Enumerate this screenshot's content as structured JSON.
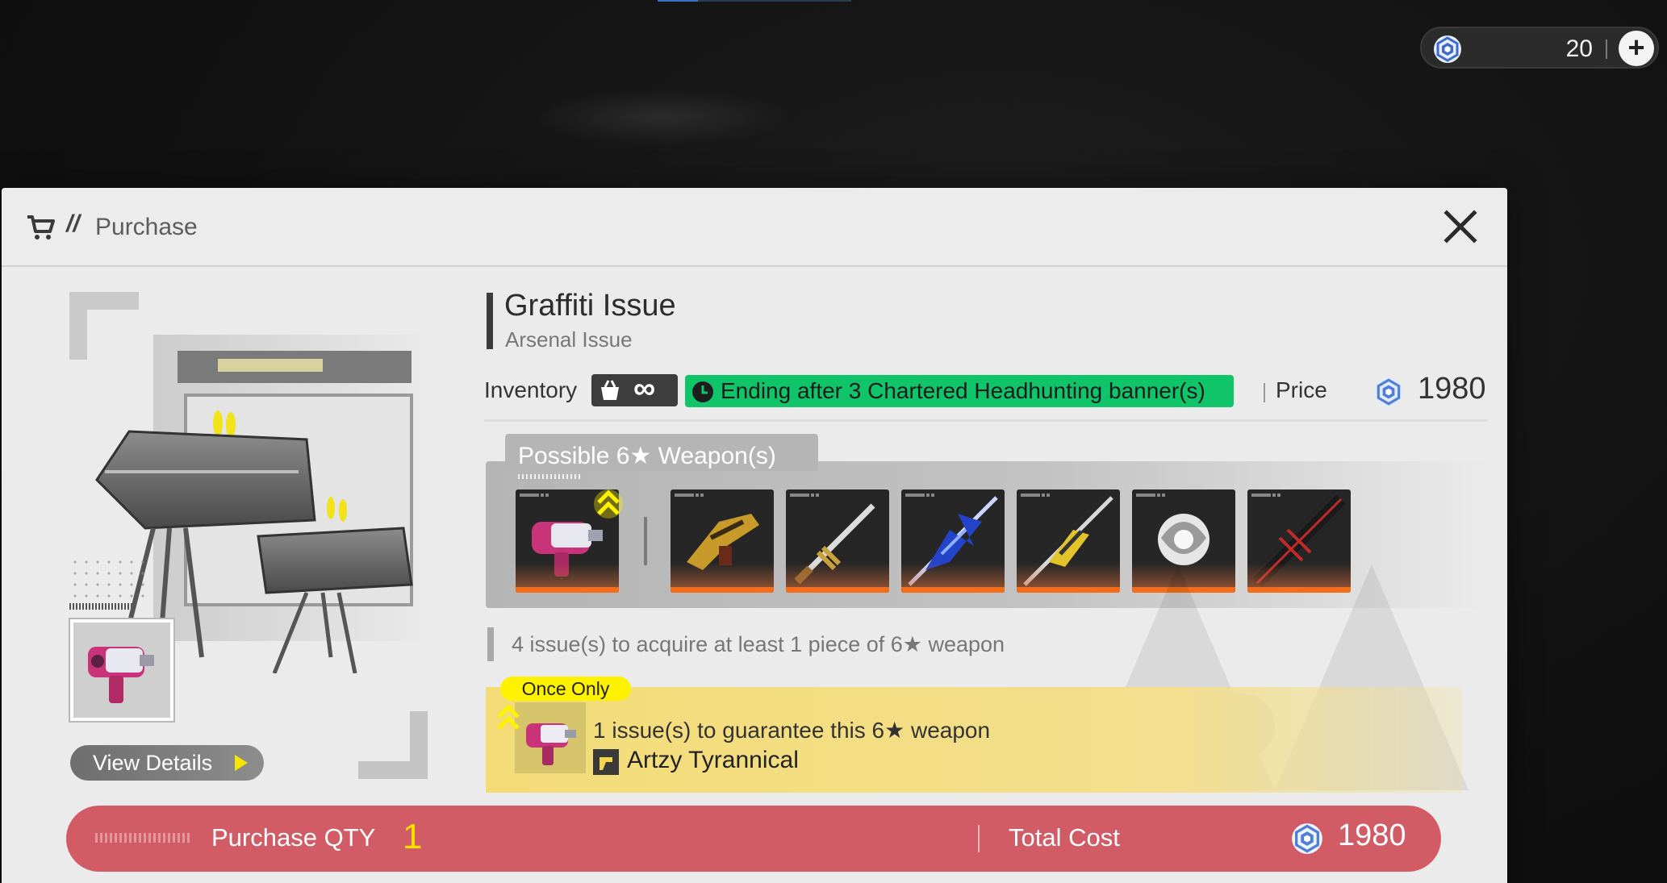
{
  "topbar": {
    "currency_icon": "origeometry-icon",
    "currency_amount": "20",
    "add_label": "+"
  },
  "dialog": {
    "header": {
      "icon": "cart-icon",
      "slashes": "//",
      "title": "Purchase",
      "close_icon": "close-icon"
    },
    "item": {
      "title": "Graffiti Issue",
      "subtitle": "Arsenal Issue",
      "inventory_label": "Inventory",
      "inventory_value": "∞",
      "ending_text": "Ending after 3 Chartered Headhunting banner(s)",
      "price_label": "Price",
      "price_value": "1980"
    },
    "weapons": {
      "tab_label": "Possible 6★ Weapon(s)",
      "items": [
        {
          "name": "featured-weapon",
          "rate_up": true
        },
        {
          "name": "weapon-2"
        },
        {
          "name": "weapon-3"
        },
        {
          "name": "weapon-4"
        },
        {
          "name": "weapon-5"
        },
        {
          "name": "weapon-6"
        },
        {
          "name": "weapon-7"
        }
      ]
    },
    "note": "4 issue(s) to acquire at least 1 piece of 6★ weapon",
    "guarantee": {
      "badge": "Once Only",
      "text": "1 issue(s) to guarantee this 6★ weapon",
      "weapon_name": "Artzy Tyrannical"
    },
    "showcase": {
      "view_details_label": "View Details"
    },
    "purchase": {
      "qty_label": "Purchase QTY",
      "qty_value": "1",
      "total_label": "Total Cost",
      "total_value": "1980"
    }
  },
  "colors": {
    "accent_green": "#10c46a",
    "rarity_orange": "#f36d1a",
    "purchase_bar": "#d25c65",
    "guarantee_yellow": "#f3dc77",
    "badge_yellow": "#fff200"
  }
}
